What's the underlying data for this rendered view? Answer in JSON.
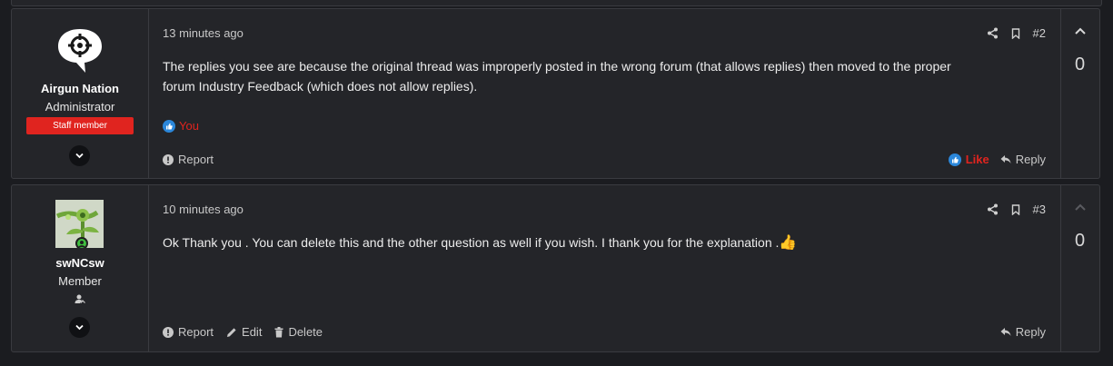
{
  "posts": [
    {
      "number": "#2",
      "time": "13 minutes ago",
      "user": {
        "name": "Airgun Nation",
        "title": "Administrator",
        "badge": "Staff member"
      },
      "message_lines": [
        "The replies you see are because the original thread was improperly posted in the wrong forum (that allows replies) then moved to the proper",
        "forum Industry Feedback (which does not allow replies)."
      ],
      "reaction_user": "You",
      "actions": {
        "report": "Report",
        "like": "Like",
        "reply": "Reply"
      },
      "votes": "0"
    },
    {
      "number": "#3",
      "time": "10 minutes ago",
      "user": {
        "name": "swNCsw",
        "title": "Member"
      },
      "message": "Ok Thank you . You can delete this and the other question as well if you wish. I thank you for the explanation .",
      "actions": {
        "report": "Report",
        "edit": "Edit",
        "delete": "Delete",
        "reply": "Reply"
      },
      "votes": "0"
    }
  ],
  "icons": {
    "share": "share-icon",
    "bookmark": "bookmark-icon",
    "report": "report-icon",
    "like": "like-icon",
    "reply": "reply-icon",
    "edit": "edit-icon",
    "delete": "trash-icon",
    "upvote": "chevron-up-icon",
    "expand": "chevron-down-icon",
    "thumbs_up": "thumbs-up-emoji"
  },
  "colors": {
    "accent_red": "#e0241f",
    "like_blue": "#2b87da",
    "bg": "#1b1c20",
    "panel": "#242529"
  }
}
